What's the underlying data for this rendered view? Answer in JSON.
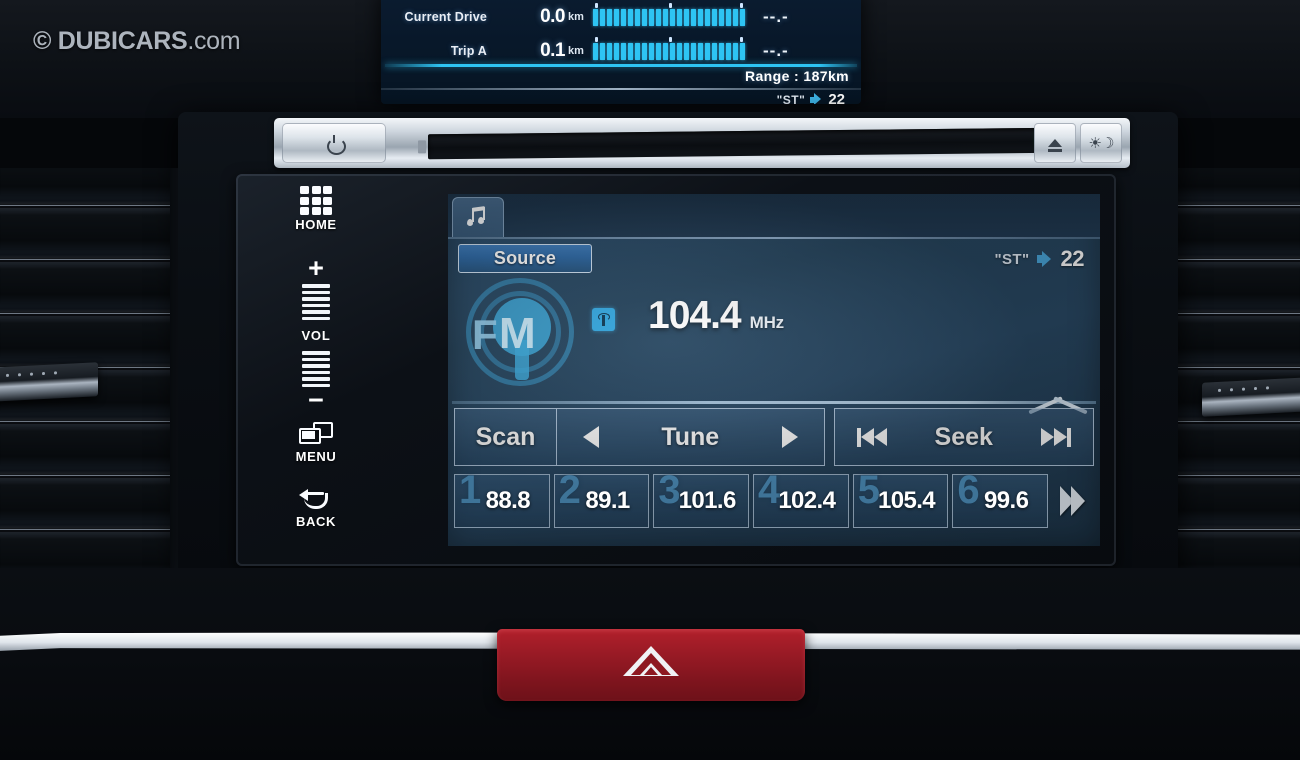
{
  "watermark": {
    "symbol": "©",
    "brand": "DUBICARS",
    "domain": ".com"
  },
  "instrument_cluster": {
    "rows": [
      {
        "label": "Current Drive",
        "value": "0.0",
        "unit": "km",
        "aux": "--.-"
      },
      {
        "label": "Trip A",
        "value": "0.1",
        "unit": "km",
        "aux": "--.-"
      }
    ],
    "range_label": "Range :",
    "range_value": "187km",
    "stereo": "\"ST\"",
    "volume": "22"
  },
  "head_unit": {
    "power_button": "power-icon",
    "cd_slot": "cd-slot",
    "led_status": "green",
    "eject_button": "eject-icon",
    "brightness_button": "☀☽"
  },
  "hard_keys": [
    {
      "label": "HOME",
      "icon": "grid-icon"
    },
    {
      "label": "VOL",
      "icon": "volume-slider-icon",
      "plus": "+",
      "minus": "−"
    },
    {
      "label": "MENU",
      "icon": "menu-icon"
    },
    {
      "label": "BACK",
      "icon": "back-arrow-icon"
    }
  ],
  "screen": {
    "tab_icon": "music-note-icon",
    "source_button": "Source",
    "stereo_indicator": "\"ST\"",
    "volume": "22",
    "band_logo_f": "F",
    "band_logo_m": "M",
    "rds_icon": "radio-tower-icon",
    "frequency": "104.4",
    "frequency_unit": "MHz",
    "controls": {
      "scan": "Scan",
      "tune": "Tune",
      "seek": "Seek",
      "tune_prev_icon": "triangle-left-icon",
      "tune_next_icon": "triangle-right-icon",
      "seek_prev_icon": "skip-back-icon",
      "seek_next_icon": "skip-forward-icon"
    },
    "presets": [
      {
        "number": "1",
        "frequency": "88.8"
      },
      {
        "number": "2",
        "frequency": "89.1"
      },
      {
        "number": "3",
        "frequency": "101.6"
      },
      {
        "number": "4",
        "frequency": "102.4"
      },
      {
        "number": "5",
        "frequency": "105.4"
      },
      {
        "number": "6",
        "frequency": "99.6"
      }
    ],
    "next_page_icon": "double-chevron-right-icon"
  },
  "hazard_button": {
    "icon": "hazard-triangle-icon",
    "color": "#9c1b26"
  },
  "colors": {
    "screen_bg": "#2a4a66",
    "accent_cyan": "#2ec4f3",
    "source_blue": "#2f6aa6",
    "hazard_red": "#9c1b26",
    "led_green": "#2ce54a"
  }
}
